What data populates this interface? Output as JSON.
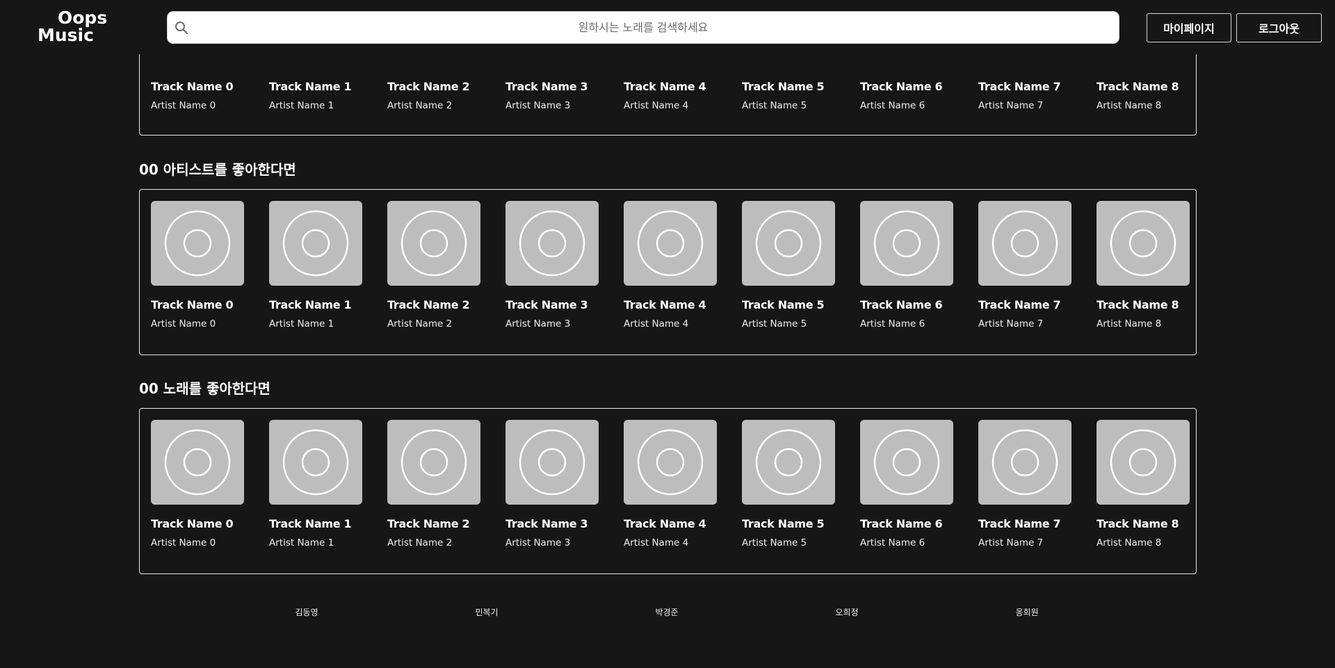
{
  "header": {
    "logo_line1": "Oops",
    "logo_line2": "Music",
    "search_placeholder": "원하시는 노래를 검색하세요",
    "mypage_label": "마이페이지",
    "logout_label": "로그아웃"
  },
  "sections": [
    {
      "title": "",
      "cards": [
        {
          "track": "Track Name 0",
          "artist": "Artist Name 0"
        },
        {
          "track": "Track Name 1",
          "artist": "Artist Name 1"
        },
        {
          "track": "Track Name 2",
          "artist": "Artist Name 2"
        },
        {
          "track": "Track Name 3",
          "artist": "Artist Name 3"
        },
        {
          "track": "Track Name 4",
          "artist": "Artist Name 4"
        },
        {
          "track": "Track Name 5",
          "artist": "Artist Name 5"
        },
        {
          "track": "Track Name 6",
          "artist": "Artist Name 6"
        },
        {
          "track": "Track Name 7",
          "artist": "Artist Name 7"
        },
        {
          "track": "Track Name 8",
          "artist": "Artist Name 8"
        }
      ]
    },
    {
      "title": "00 아티스트를 좋아한다면",
      "cards": [
        {
          "track": "Track Name 0",
          "artist": "Artist Name 0"
        },
        {
          "track": "Track Name 1",
          "artist": "Artist Name 1"
        },
        {
          "track": "Track Name 2",
          "artist": "Artist Name 2"
        },
        {
          "track": "Track Name 3",
          "artist": "Artist Name 3"
        },
        {
          "track": "Track Name 4",
          "artist": "Artist Name 4"
        },
        {
          "track": "Track Name 5",
          "artist": "Artist Name 5"
        },
        {
          "track": "Track Name 6",
          "artist": "Artist Name 6"
        },
        {
          "track": "Track Name 7",
          "artist": "Artist Name 7"
        },
        {
          "track": "Track Name 8",
          "artist": "Artist Name 8"
        }
      ]
    },
    {
      "title": "00 노래를 좋아한다면",
      "cards": [
        {
          "track": "Track Name 0",
          "artist": "Artist Name 0"
        },
        {
          "track": "Track Name 1",
          "artist": "Artist Name 1"
        },
        {
          "track": "Track Name 2",
          "artist": "Artist Name 2"
        },
        {
          "track": "Track Name 3",
          "artist": "Artist Name 3"
        },
        {
          "track": "Track Name 4",
          "artist": "Artist Name 4"
        },
        {
          "track": "Track Name 5",
          "artist": "Artist Name 5"
        },
        {
          "track": "Track Name 6",
          "artist": "Artist Name 6"
        },
        {
          "track": "Track Name 7",
          "artist": "Artist Name 7"
        },
        {
          "track": "Track Name 8",
          "artist": "Artist Name 8"
        }
      ]
    }
  ],
  "footer": {
    "members": [
      "김동영",
      "민복기",
      "박경준",
      "오희정",
      "옹희원"
    ]
  },
  "colors": {
    "background": "#161616",
    "album_placeholder": "#bdbdbd",
    "border": "#e8e8e8"
  },
  "icons": {
    "search": "search-icon",
    "album": "album-disc-icon"
  }
}
